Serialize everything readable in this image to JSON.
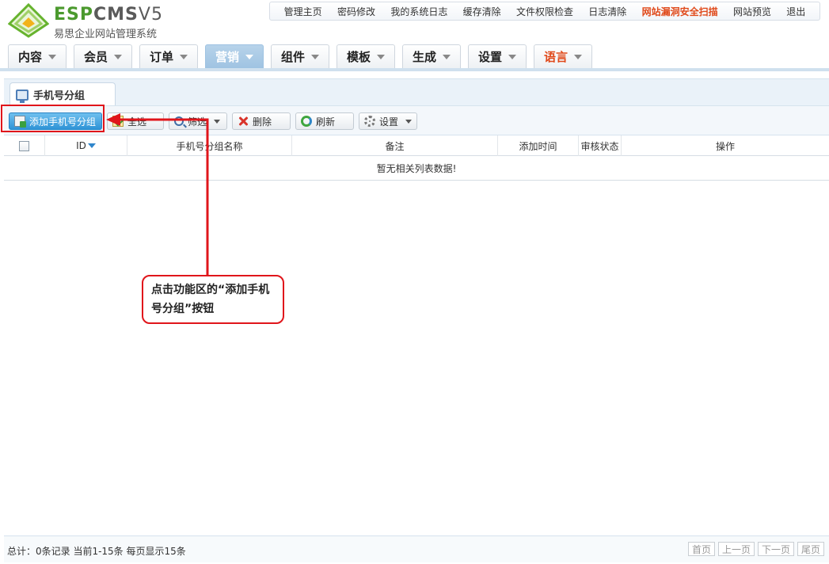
{
  "header": {
    "brand": {
      "esp": "ESP",
      "cms": "CMS",
      "ver": "V5"
    },
    "subtitle": "易思企业网站管理系统",
    "toplinks": [
      "管理主页",
      "密码修改",
      "我的系统日志",
      "缓存清除",
      "文件权限检查",
      "日志清除",
      "网站漏洞安全扫描",
      "网站预览",
      "退出"
    ],
    "highlight_link_index": 6,
    "nav_tabs": [
      "内容",
      "会员",
      "订单",
      "营销",
      "组件",
      "模板",
      "生成",
      "设置",
      "语言"
    ],
    "active_tab_index": 3
  },
  "panel": {
    "tab_title": "手机号分组"
  },
  "toolbar": {
    "add": "添加手机号分组",
    "select_all": "全选",
    "filter": "筛选",
    "delete": "删除",
    "refresh": "刷新",
    "settings": "设置"
  },
  "table": {
    "columns": [
      "ID",
      "手机号分组名称",
      "备注",
      "添加时间",
      "审核状态",
      "操作"
    ],
    "empty_text": "暂无相关列表数据!"
  },
  "footer": {
    "summary": "总计：0条记录 当前1-15条 每页显示15条",
    "pager": [
      "首页",
      "上一页",
      "下一页",
      "尾页"
    ]
  },
  "annotation": {
    "text": "点击功能区的“添加手机号分组”按钮"
  },
  "colors": {
    "accent_blue": "#2f93d6",
    "highlight_red": "#e0151b",
    "orange_link": "#e0491a",
    "logo_green": "#4b9a2e"
  }
}
